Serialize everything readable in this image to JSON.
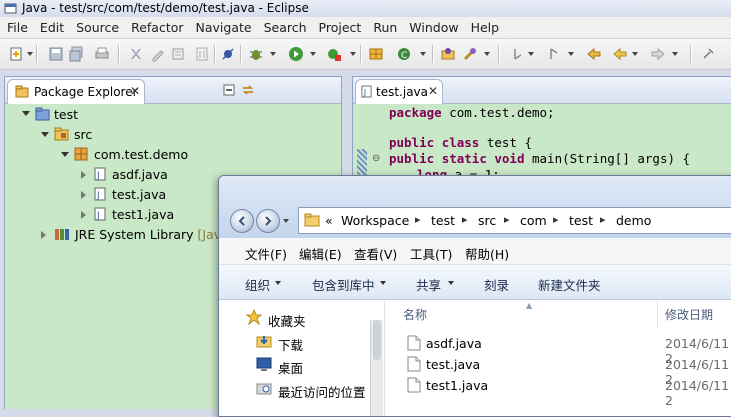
{
  "window": {
    "title": "Java - test/src/com/test/demo/test.java - Eclipse"
  },
  "menu": [
    "File",
    "Edit",
    "Source",
    "Refactor",
    "Navigate",
    "Search",
    "Project",
    "Run",
    "Window",
    "Help"
  ],
  "package_explorer": {
    "tab_label": "Package Explorer",
    "tree": {
      "project": "test",
      "src": "src",
      "package": "com.test.demo",
      "files": [
        "asdf.java",
        "test.java",
        "test1.java"
      ],
      "library": "JRE System Library",
      "library_suffix": "[JavaS"
    }
  },
  "editor": {
    "tab_label": "test.java",
    "code": {
      "line1_kw": "package",
      "line1_rest": " com.test.demo;",
      "line2_kw1": "public",
      "line2_kw2": "class",
      "line2_rest": " test {",
      "line3_kw1": "public",
      "line3_kw2": "static",
      "line3_kw3": "void",
      "line3_rest": " main(String[] args) {",
      "line4_kw": "long",
      "line4_rest": " a = 1;"
    }
  },
  "explorer": {
    "breadcrumb": [
      "Workspace",
      "test",
      "src",
      "com",
      "test",
      "demo"
    ],
    "breadcrumb_prefix": "«",
    "menu": [
      "文件(F)",
      "编辑(E)",
      "查看(V)",
      "工具(T)",
      "帮助(H)"
    ],
    "commands": [
      "组织",
      "包含到库中",
      "共享",
      "刻录",
      "新建文件夹"
    ],
    "nav": [
      "收藏夹",
      "下载",
      "桌面",
      "最近访问的位置"
    ],
    "columns": {
      "name": "名称",
      "modified": "修改日期"
    },
    "files": [
      {
        "name": "asdf.java",
        "date": "2014/6/11 2"
      },
      {
        "name": "test.java",
        "date": "2014/6/11 2"
      },
      {
        "name": "test1.java",
        "date": "2014/6/11 2"
      }
    ]
  },
  "colors": {
    "view_background": "#c9e8c7",
    "keyword": "#7f0055"
  }
}
